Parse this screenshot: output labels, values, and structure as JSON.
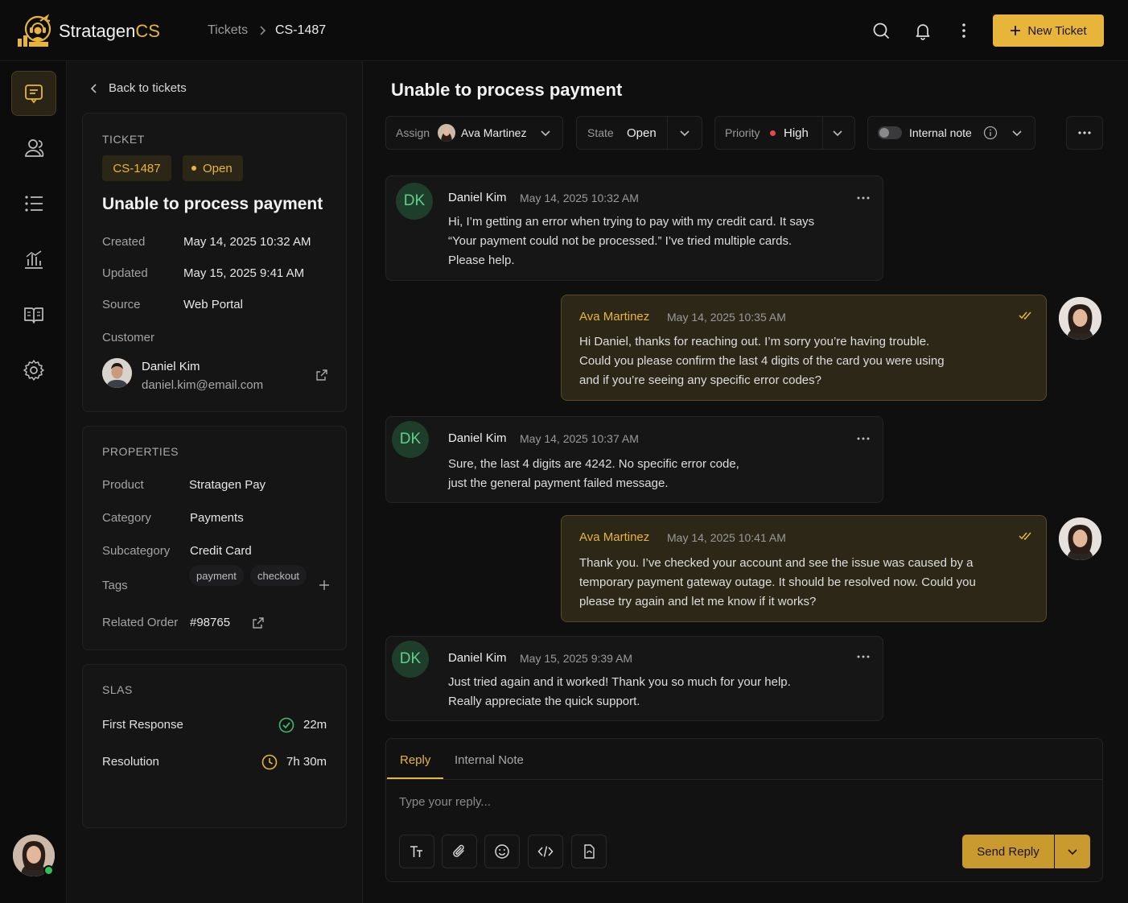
{
  "app": {
    "brand_main": "Stratagen",
    "brand_accent": "CS"
  },
  "breadcrumb": {
    "tickets": "Tickets",
    "current": "CS-1487"
  },
  "topbar": {
    "new_ticket_label": "New Ticket"
  },
  "back_label": "Back to tickets",
  "ticket": {
    "section_title": "TICKET",
    "id": "CS-1487",
    "status": "Open",
    "title": "Unable to process payment",
    "fields": [
      {
        "label": "Created",
        "value": "May 14, 2025 10:32 AM"
      },
      {
        "label": "Updated",
        "value": "May 15, 2025 9:41 AM"
      },
      {
        "label": "Source",
        "value": "Web Portal"
      }
    ],
    "customer_label": "Customer",
    "customer": {
      "name": "Daniel Kim",
      "email": "daniel.kim@email.com"
    }
  },
  "properties": {
    "section_title": "PROPERTIES",
    "product_label": "Product",
    "product": "Stratagen Pay",
    "category_label": "Category",
    "category": "Payments",
    "subcategory_label": "Subcategory",
    "subcategory": "Credit Card",
    "tags_label": "Tags",
    "tags": [
      "payment",
      "checkout"
    ],
    "related_order_label": "Related Order",
    "related_order": "#98765"
  },
  "slas": {
    "section_title": "SLAS",
    "first_response_label": "First Response",
    "first_response": "22m",
    "resolution_label": "Resolution",
    "resolution": "7h 30m"
  },
  "controls": {
    "assign_label": "Assign",
    "assignee": "Ava Martinez",
    "state_label": "State",
    "state": "Open",
    "priority_label": "Priority",
    "priority": "High",
    "internal_note_label": "Internal note"
  },
  "messages": [
    {
      "sender": "Daniel Kim",
      "initials": "DK",
      "time": "May 14, 2025 10:32 AM",
      "lines": [
        "Hi, I’m getting an error when trying to pay with my credit card. It says",
        "“Your payment could not be processed.” I’ve tried multiple cards.",
        "Please help."
      ]
    },
    {
      "sender": "Ava Martinez",
      "time": "May 14, 2025 10:35 AM",
      "lines": [
        "Hi Daniel, thanks for reaching out. I’m sorry you’re having trouble.",
        "Could you please confirm the last 4 digits of the card you were using",
        "and if you’re seeing any specific error codes?"
      ]
    },
    {
      "sender": "Daniel Kim",
      "initials": "DK",
      "time": "May 14, 2025 10:37 AM",
      "lines": [
        "Sure, the last 4 digits are 4242. No specific error code,",
        "just the general payment failed message."
      ]
    },
    {
      "sender": "Ava Martinez",
      "time": "May 14, 2025 10:41 AM",
      "lines": [
        "Thank you. I’ve checked your account and see the issue was caused by a",
        "temporary payment gateway outage. It should be resolved now. Could you",
        "please try again and let me know if it works?"
      ]
    },
    {
      "sender": "Daniel Kim",
      "initials": "DK",
      "time": "May 15, 2025 9:39 AM",
      "lines": [
        "Just tried again and it worked! Thank you so much for your help.",
        "Really appreciate the quick support."
      ]
    }
  ],
  "reply": {
    "tab_reply": "Reply",
    "tab_note": "Internal Note",
    "placeholder": "Type your reply...",
    "send_label": "Send Reply"
  },
  "colors": {
    "accent": "#e8b53b",
    "priority_high": "#e5484d",
    "sla_ok": "#3fb96a",
    "online": "#32c25a"
  }
}
